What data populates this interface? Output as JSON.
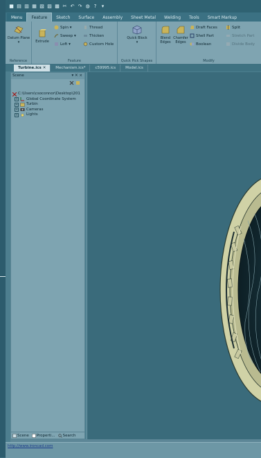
{
  "menu_tabs": [
    "Menu",
    "Feature",
    "Sketch",
    "Surface",
    "Assembly",
    "Sheet Metal",
    "Welding",
    "Tools",
    "Smart Markup"
  ],
  "active_tab": "Feature",
  "ribbon": {
    "reference": {
      "label": "Reference",
      "datum_plane": "Datum Plane ▾"
    },
    "feature": {
      "label": "Feature",
      "extrude": "Extrude",
      "spin": "Spin ▾",
      "sweep": "Sweep ▾",
      "loft": "Loft ▾",
      "thread": "Thread",
      "thicken": "Thicken",
      "custom_hole": "Custom Hole"
    },
    "quick_pick": {
      "label": "Quick Pick Shapes",
      "quick_block": "Quick Block ▾"
    },
    "modify": {
      "label": "Modify",
      "blend_edges": "Blend Edges",
      "chamfer_edges": "Chamfer Edges",
      "draft_faces": "Draft Faces",
      "shell_part": "Shell Part",
      "boolean": "Boolean",
      "split": "Split",
      "stretch_part": "Stretch Part",
      "divide_body": "Divide Body"
    }
  },
  "doc_tabs": [
    "Turbine.ics",
    "Mechanism.ics*",
    "c59995.ics",
    "Model.ics"
  ],
  "active_doc": "Turbine.ics",
  "scene_panel": {
    "title": "Scene",
    "ctrls": "▾ ✕ ×",
    "tree": [
      {
        "label": "C:\\Users\\csoconnor\\Desktop\\201",
        "indent": 0
      },
      {
        "label": "Global Coordinate System",
        "indent": 1
      },
      {
        "label": "Turbin",
        "indent": 1
      },
      {
        "label": "Cameras",
        "indent": 1
      },
      {
        "label": "Lights",
        "indent": 1
      }
    ],
    "footer_tabs": [
      "Scene",
      "Properti...",
      "Search"
    ]
  },
  "status_link": "http://www.ironcad.com",
  "colors": {
    "ribbon": "#7fa4b1",
    "viewport": "#3a6b7b",
    "turbine": "#c8c9a0"
  }
}
